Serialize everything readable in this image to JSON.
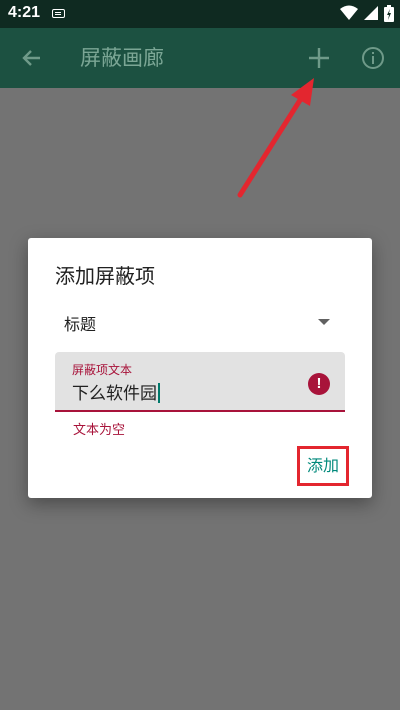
{
  "status_bar": {
    "time": "4:21",
    "icons": [
      "keyboard-icon",
      "wifi-icon",
      "signal-icon",
      "battery-icon"
    ]
  },
  "app_bar": {
    "title": "屏蔽画廊",
    "icons": [
      "back-arrow-icon",
      "add-icon",
      "info-icon"
    ]
  },
  "dialog": {
    "title": "添加屏蔽项",
    "dropdown": {
      "selected": "标题"
    },
    "text_field": {
      "label": "屏蔽项文本",
      "value": "下么软件园",
      "error_helper": "文本为空"
    },
    "add_button_label": "添加"
  },
  "colors": {
    "status_bar": "#0f2a21",
    "app_bar": "#1c5141",
    "error": "#a8133a",
    "accent": "#00897b",
    "annotation": "#e3262f"
  }
}
